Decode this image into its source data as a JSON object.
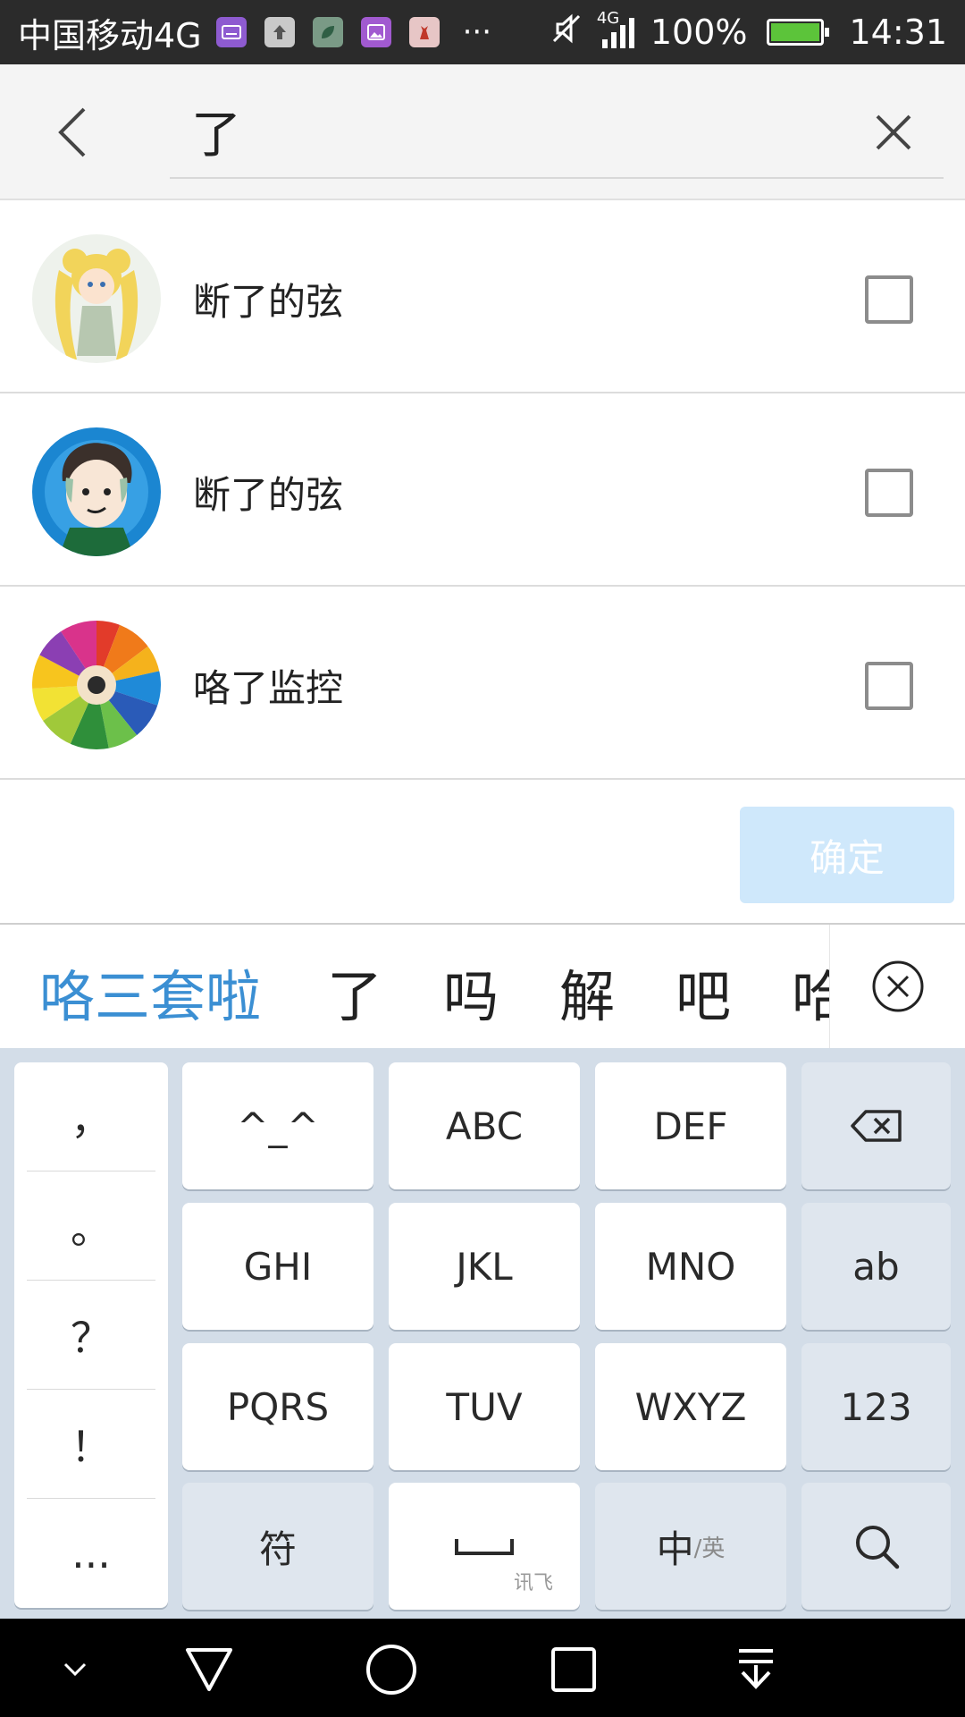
{
  "status_bar": {
    "carrier": "中国移动4G",
    "network": "4G",
    "battery": "100%",
    "time": "14:31",
    "more": "···"
  },
  "search": {
    "query": "了"
  },
  "contacts": [
    {
      "name": "断了的弦",
      "checked": false,
      "avatar": "sailor-moon-avatar"
    },
    {
      "name": "断了的弦",
      "checked": false,
      "avatar": "cartoon-boy-avatar"
    },
    {
      "name": "咯了监控",
      "checked": false,
      "avatar": "color-pencils-avatar"
    }
  ],
  "confirm_label": "确定",
  "candidates": [
    "咯三套啦",
    "了",
    "吗",
    "解",
    "吧",
    "哈"
  ],
  "keyboard": {
    "punct": [
      "，",
      "。",
      "？",
      "！",
      "..."
    ],
    "keys": [
      [
        "^_^",
        "ABC",
        "DEF"
      ],
      [
        "GHI",
        "JKL",
        "MNO"
      ],
      [
        "PQRS",
        "TUV",
        "WXYZ"
      ]
    ],
    "side": [
      "ab",
      "123"
    ],
    "bottom": {
      "symbol": "符",
      "space_sub": "讯飞",
      "zh": "中",
      "en": "/英"
    }
  },
  "colors": {
    "accent": "#3b8fd3",
    "confirm_bg": "#cfe8fb",
    "keyboard_bg": "#d3dde8"
  }
}
